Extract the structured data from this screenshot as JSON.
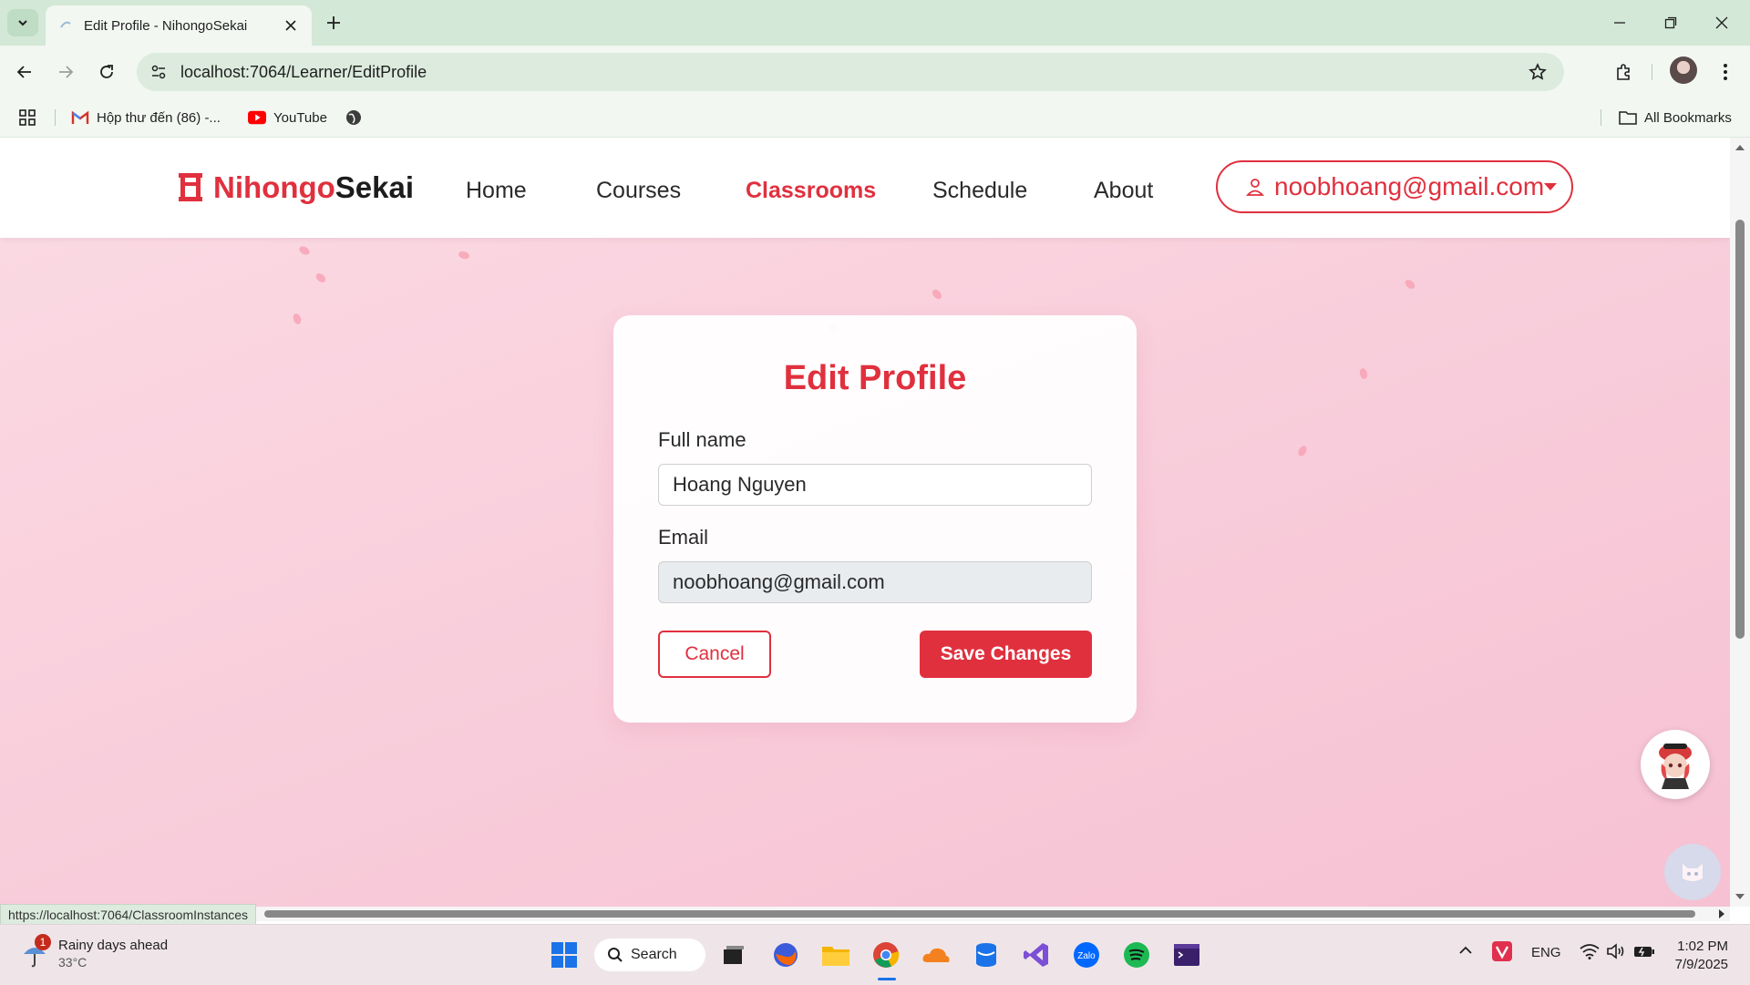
{
  "browser": {
    "tab_title": "Edit Profile - NihongoSekai",
    "url": "localhost:7064/Learner/EditProfile",
    "bookmarks": [
      {
        "label": "Hộp thư đến (86) -...",
        "icon": "gmail-icon"
      },
      {
        "label": "YouTube",
        "icon": "youtube-icon"
      }
    ],
    "all_bookmarks_label": "All Bookmarks",
    "status_url": "https://localhost:7064/ClassroomInstances"
  },
  "site": {
    "brand_part1": "Nihongo",
    "brand_part2": "Sekai",
    "nav": [
      {
        "label": "Home",
        "active": false
      },
      {
        "label": "Courses",
        "active": false
      },
      {
        "label": "Classrooms",
        "active": true
      },
      {
        "label": "Schedule",
        "active": false
      },
      {
        "label": "About",
        "active": false
      }
    ],
    "user_email": "noobhoang@gmail.com",
    "accent_color": "#e0303e"
  },
  "form": {
    "title": "Edit Profile",
    "full_name_label": "Full name",
    "full_name_value": "Hoang Nguyen",
    "email_label": "Email",
    "email_value": "noobhoang@gmail.com",
    "cancel_label": "Cancel",
    "save_label": "Save Changes"
  },
  "taskbar": {
    "weather_title": "Rainy days ahead",
    "weather_temp": "33°C",
    "weather_badge": "1",
    "search_label": "Search",
    "language": "ENG",
    "time": "1:02 PM",
    "date": "7/9/2025"
  }
}
